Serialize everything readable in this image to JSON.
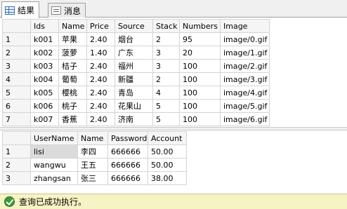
{
  "tabs": [
    {
      "label": "结果",
      "icon": "grid-icon",
      "active": true
    },
    {
      "label": "消息",
      "icon": "message-icon",
      "active": false
    }
  ],
  "products": {
    "columns": [
      "Ids",
      "Name",
      "Price",
      "Source",
      "Stack",
      "Numbers",
      "Image"
    ],
    "rows": [
      {
        "rn": "1",
        "cells": [
          "k001",
          "苹果",
          "2.40",
          "烟台",
          "2",
          "95",
          "image/0.gif"
        ]
      },
      {
        "rn": "2",
        "cells": [
          "k002",
          "菠萝",
          "1.40",
          "广东",
          "3",
          "20",
          "image/1.gif"
        ]
      },
      {
        "rn": "3",
        "cells": [
          "k003",
          "桔子",
          "2.40",
          "福州",
          "3",
          "100",
          "image/2.gif"
        ]
      },
      {
        "rn": "4",
        "cells": [
          "k004",
          "葡萄",
          "2.40",
          "新疆",
          "2",
          "100",
          "image/3.gif"
        ]
      },
      {
        "rn": "5",
        "cells": [
          "k005",
          "樱桃",
          "2.40",
          "青岛",
          "4",
          "100",
          "image/4.gif"
        ]
      },
      {
        "rn": "6",
        "cells": [
          "k006",
          "桃子",
          "2.40",
          "花果山",
          "5",
          "100",
          "image/5.gif"
        ]
      },
      {
        "rn": "7",
        "cells": [
          "k007",
          "香蕉",
          "2.40",
          "济南",
          "5",
          "100",
          "image/6.gif"
        ]
      }
    ]
  },
  "users": {
    "columns": [
      "UserName",
      "Name",
      "Password",
      "Account"
    ],
    "rows": [
      {
        "rn": "1",
        "cells": [
          "lisi",
          "李四",
          "666666",
          "50.00"
        ]
      },
      {
        "rn": "2",
        "cells": [
          "wangwu",
          "王五",
          "666666",
          "50.00"
        ]
      },
      {
        "rn": "3",
        "cells": [
          "zhangsan",
          "张三",
          "666666",
          "38.00"
        ]
      }
    ]
  },
  "status": {
    "text": "查询已成功执行。",
    "icon": "success-check-icon",
    "color": "#f6f3c4"
  }
}
